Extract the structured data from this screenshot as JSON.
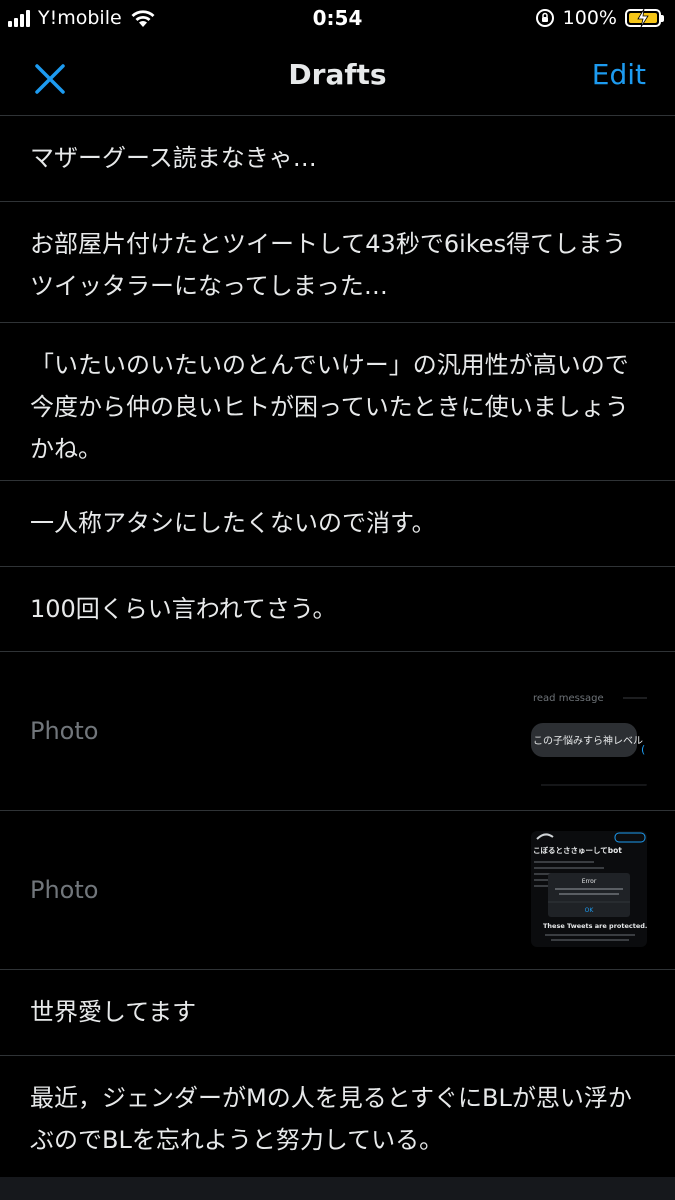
{
  "status_bar": {
    "carrier": "Y!mobile",
    "time": "0:54",
    "battery_percent": "100%",
    "battery_color": "#f5c518"
  },
  "nav": {
    "title": "Drafts",
    "edit_label": "Edit",
    "close_icon": "close-icon",
    "accent_color": "#1d9bf0"
  },
  "drafts": [
    {
      "text": "マザーグース読まなきゃ…"
    },
    {
      "text": "お部屋片付けたとツイートして43秒で6ikes得てしまうツイッタラーになってしまった…"
    },
    {
      "text": "「いたいのいたいのとんでいけー」の汎用性が高いので今度から仲の良いヒトが困っていたときに使いましょうかね。"
    },
    {
      "text": "一人称アタシにしたくないので消す。"
    },
    {
      "text": "100回くらい言われてさう。"
    },
    {
      "label": "Photo",
      "thumb_header": "read message",
      "thumb_bubble": "この子悩みすら神レベル"
    },
    {
      "label": "Photo",
      "thumb_title": "こぼるとささゅーしてbot",
      "thumb_error_title": "Error",
      "thumb_ok": "OK",
      "thumb_protected": "These Tweets are protected."
    },
    {
      "text": "世界愛してます"
    },
    {
      "text": "最近，ジェンダーがMの人を見るとすぐにBLが思い浮かぶのでBLを忘れようと努力している。"
    }
  ]
}
